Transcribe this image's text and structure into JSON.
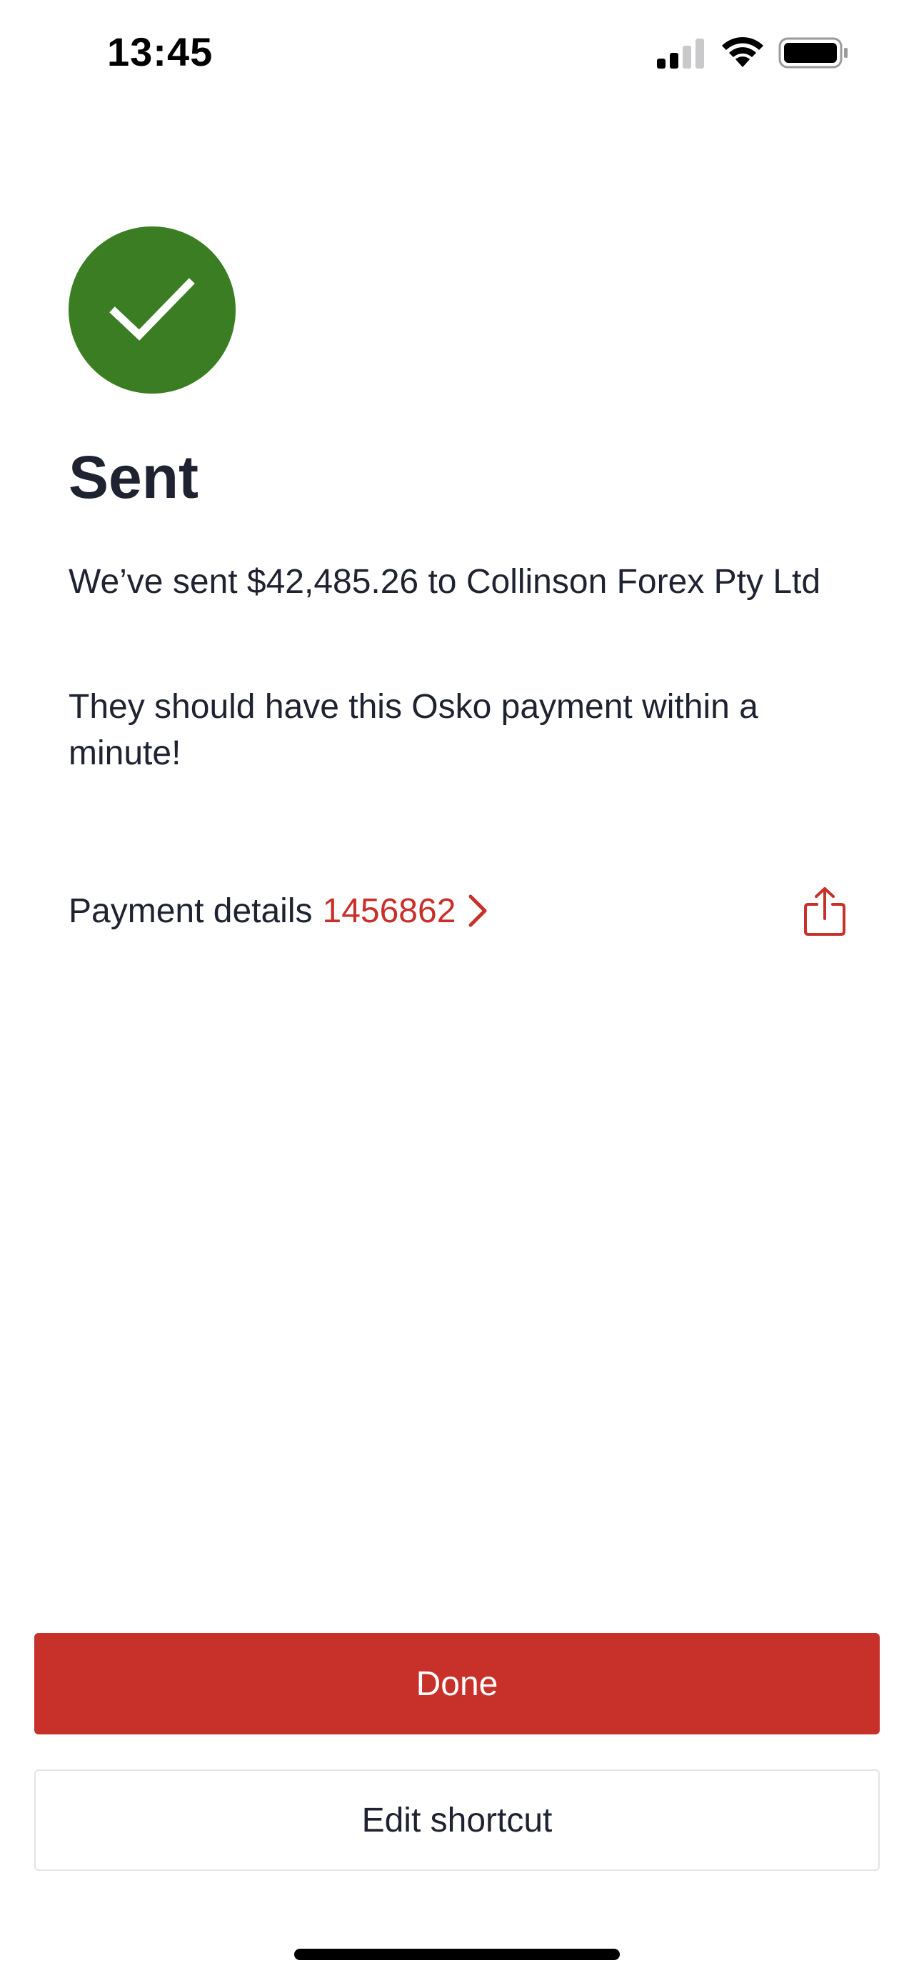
{
  "status_bar": {
    "time": "13:45",
    "icons": [
      "cellular-signal-icon",
      "wifi-icon",
      "battery-icon"
    ]
  },
  "confirmation": {
    "icon": "checkmark-icon",
    "title": "Sent",
    "message_line_1": "We’ve sent $42,485.26 to Collinson Forex Pty Ltd",
    "message_line_2": "They should have this Osko payment within a minute!"
  },
  "payment_details": {
    "label": "Payment details",
    "reference": "1456862",
    "chevron_icon": "chevron-right-icon",
    "share_icon": "share-icon"
  },
  "actions": {
    "done_label": "Done",
    "edit_shortcut_label": "Edit shortcut"
  },
  "colors": {
    "success_green": "#3a7d22",
    "brand_red": "#c8302a",
    "text_dark": "#1f2230",
    "border_light": "#e3e4e8"
  }
}
